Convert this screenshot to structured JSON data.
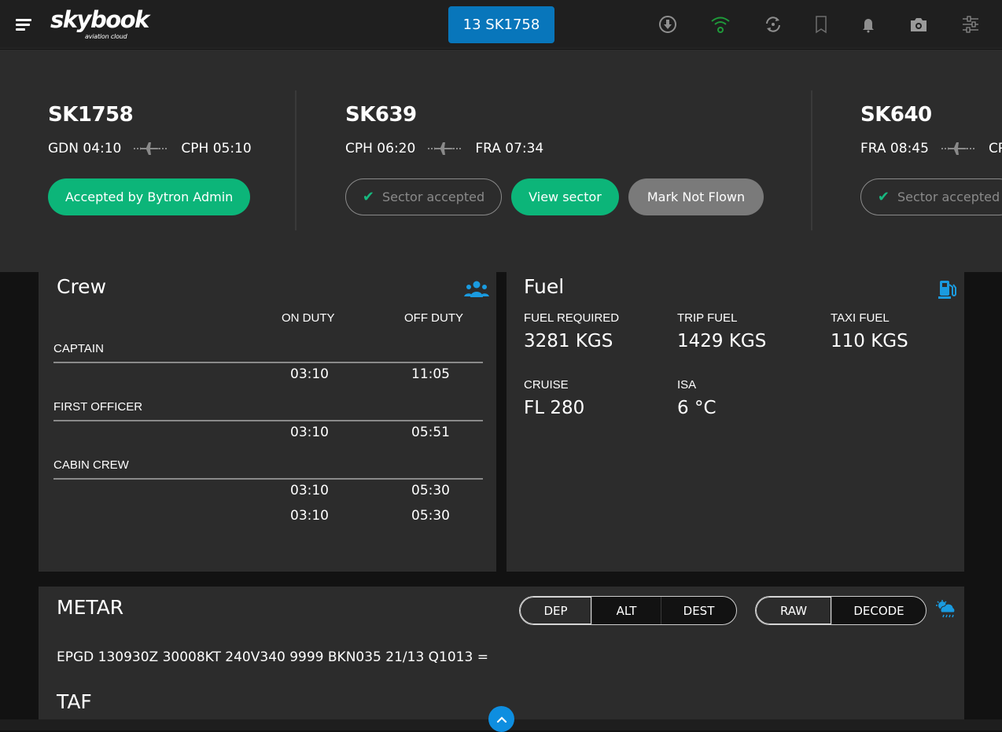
{
  "header": {
    "logo": {
      "brand": "skybook",
      "tagline": "aviation cloud"
    },
    "current_flight": "13 SK1758",
    "icons": [
      {
        "name": "download-icon",
        "state": "inactive"
      },
      {
        "name": "wifi-icon",
        "state": "connected"
      },
      {
        "name": "sync-icon",
        "state": "inactive"
      },
      {
        "name": "bookmark-icon",
        "state": "inactive"
      },
      {
        "name": "bell-icon",
        "state": "inactive"
      },
      {
        "name": "camera-icon",
        "state": "inactive"
      },
      {
        "name": "settings-sliders-icon",
        "state": "inactive"
      }
    ],
    "colors": {
      "accent": "#0876bb",
      "wifi_connected": "#1f9a3a",
      "icon_inactive": "#8f8f8f"
    }
  },
  "flights": [
    {
      "flight_no": "SK1758",
      "dep": "GDN 04:10",
      "arr": "CPH 05:10",
      "buttons": [
        {
          "label": "Accepted by Bytron Admin",
          "style": "green"
        }
      ]
    },
    {
      "flight_no": "SK639",
      "dep": "CPH 06:20",
      "arr": "FRA 07:34",
      "buttons": [
        {
          "label": "Sector accepted",
          "style": "outline",
          "icon": "check-icon"
        },
        {
          "label": "View sector",
          "style": "green"
        },
        {
          "label": "Mark Not Flown",
          "style": "grey"
        }
      ]
    },
    {
      "flight_no": "SK640",
      "dep": "FRA 08:45",
      "arr": "CPH",
      "buttons": [
        {
          "label": "Sector accepted",
          "style": "outline",
          "icon": "check-icon"
        }
      ]
    }
  ],
  "crew": {
    "title": "Crew",
    "icon": "people-icon",
    "columns": [
      "ON DUTY",
      "OFF DUTY"
    ],
    "groups": [
      {
        "role": "CAPTAIN",
        "rows": [
          {
            "on": "03:10",
            "off": "11:05"
          }
        ]
      },
      {
        "role": "FIRST OFFICER",
        "rows": [
          {
            "on": "03:10",
            "off": "05:51"
          }
        ]
      },
      {
        "role": "CABIN CREW",
        "rows": [
          {
            "on": "03:10",
            "off": "05:30"
          },
          {
            "on": "03:10",
            "off": "05:30"
          }
        ]
      }
    ]
  },
  "fuel": {
    "title": "Fuel",
    "icon": "fuel-pump-icon",
    "items": [
      {
        "label": "FUEL REQUIRED",
        "value": "3281 KGS"
      },
      {
        "label": "TRIP FUEL",
        "value": "1429 KGS"
      },
      {
        "label": "TAXI FUEL",
        "value": "110 KGS"
      },
      {
        "label": "CRUISE",
        "value": "FL 280"
      },
      {
        "label": "ISA",
        "value": "6 °C"
      }
    ]
  },
  "weather": {
    "metar_title": "METAR",
    "airport_tabs": [
      {
        "label": "DEP",
        "active": true
      },
      {
        "label": "ALT",
        "active": false
      },
      {
        "label": "DEST",
        "active": false
      }
    ],
    "format_tabs": [
      {
        "label": "RAW",
        "active": true
      },
      {
        "label": "DECODE",
        "active": false
      }
    ],
    "icon": "weather-cloud-rain-icon",
    "metar_text": "EPGD 130930Z 30008KT 240V340 9999 BKN035 21/13 Q1013 =",
    "taf_title": "TAF"
  },
  "scroll_top_icon": "chevron-up-icon"
}
